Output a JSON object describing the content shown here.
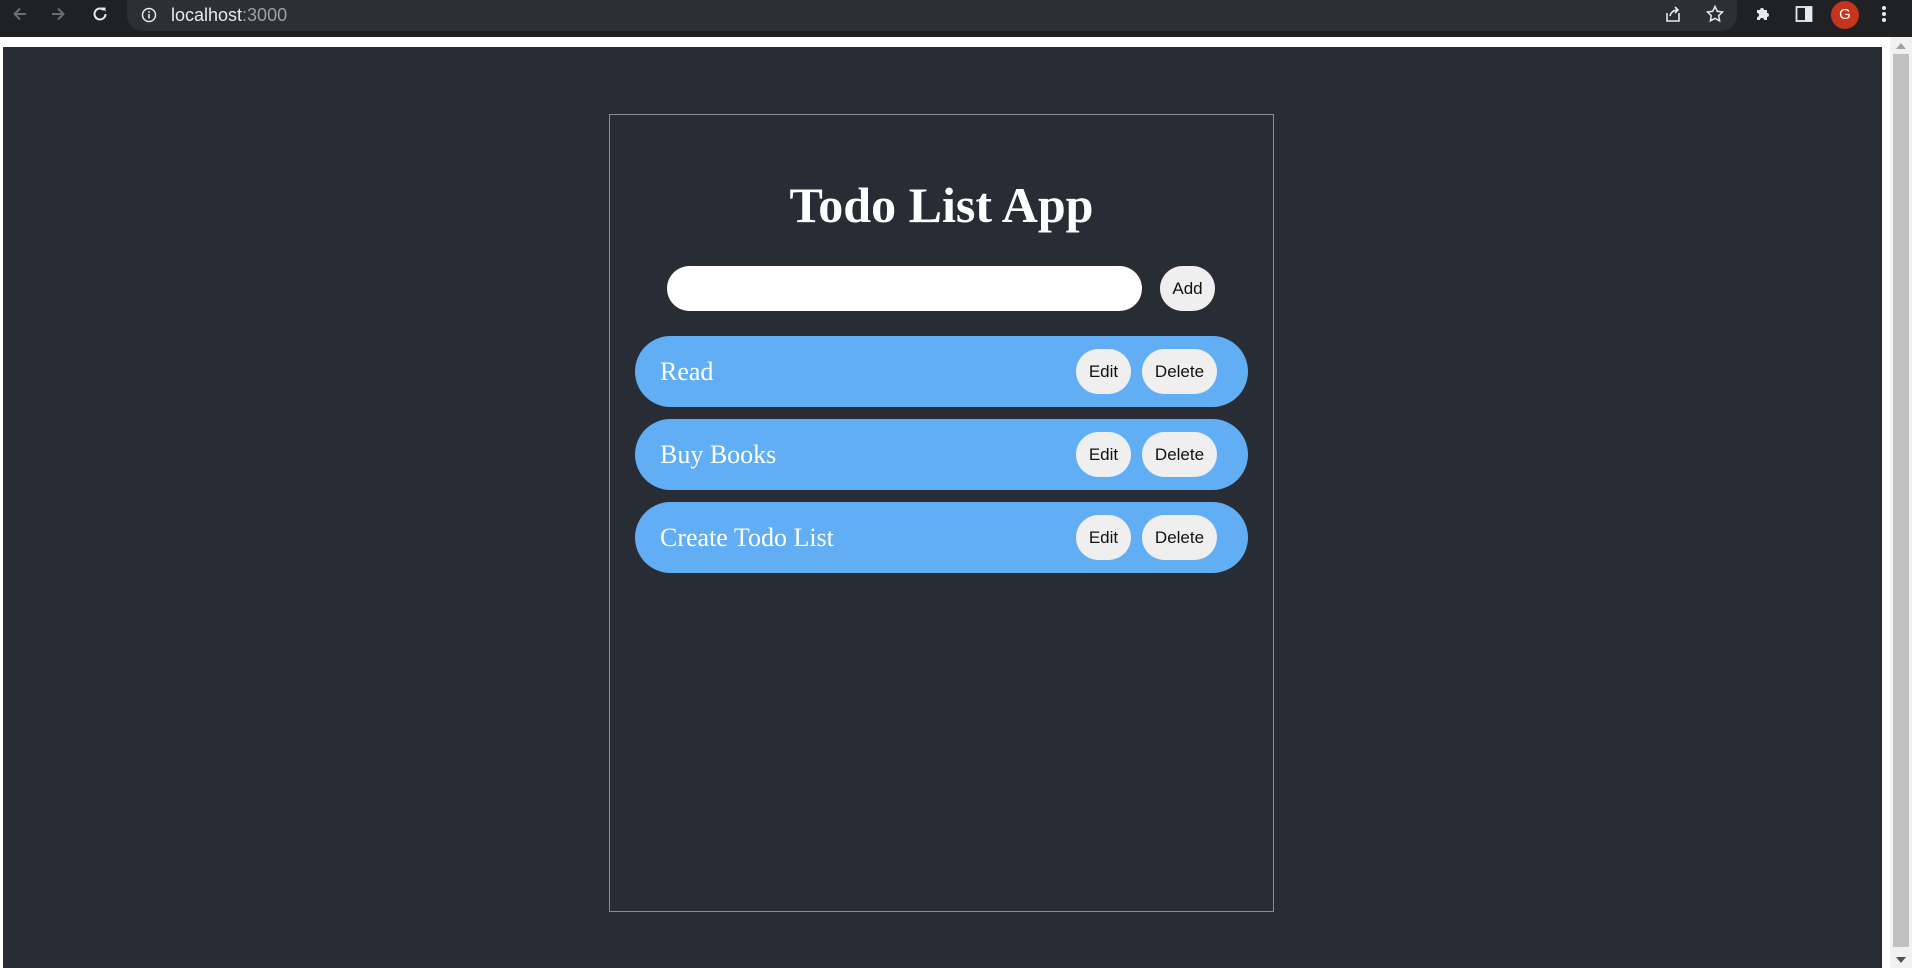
{
  "browser": {
    "url_host": "localhost",
    "url_port": ":3000",
    "profile_initial": "G"
  },
  "app": {
    "title": "Todo List App",
    "input": {
      "value": "",
      "placeholder": ""
    },
    "add_label": "Add",
    "edit_label": "Edit",
    "delete_label": "Delete",
    "todos": [
      {
        "text": "Read"
      },
      {
        "text": "Buy Books"
      },
      {
        "text": "Create Todo List"
      }
    ]
  },
  "colors": {
    "page_background": "#282c34",
    "todo_item": "#61aef5",
    "button": "#efefef",
    "avatar": "#c5341c"
  }
}
